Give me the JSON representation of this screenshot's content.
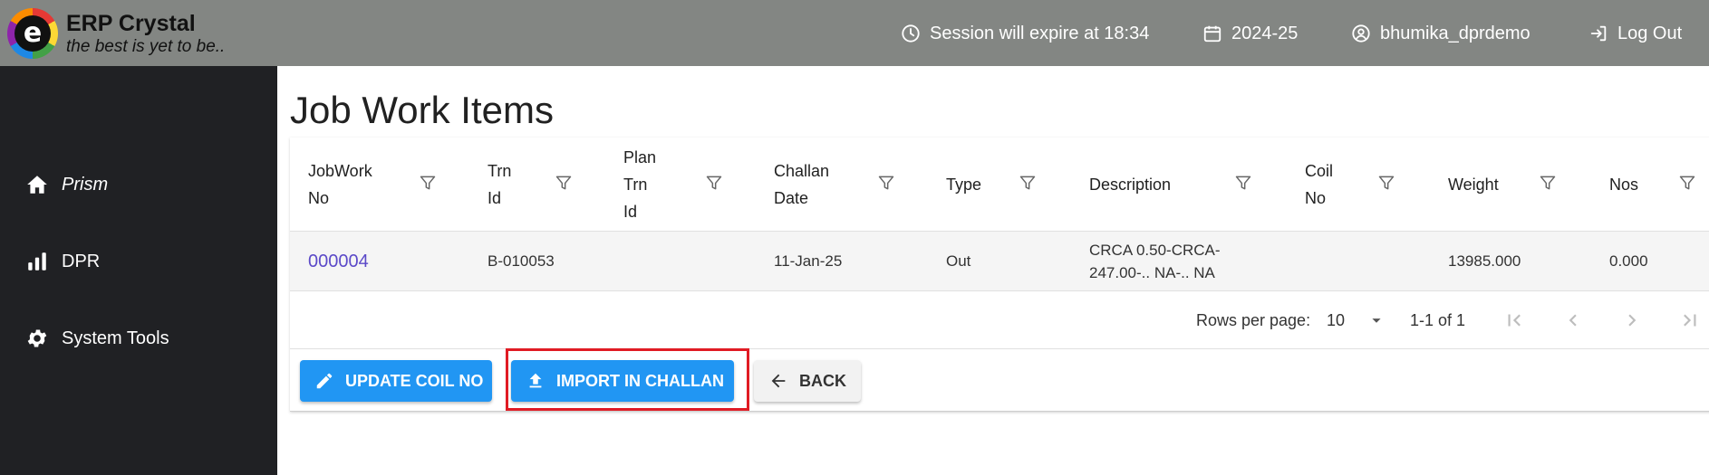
{
  "header": {
    "brand_name": "ERP Crystal",
    "brand_tagline": "the best is yet to be..",
    "session_text": "Session will expire at 18:34",
    "financial_year": "2024-25",
    "username": "bhumika_dprdemo",
    "logout_label": "Log Out",
    "bg_color": "#838683"
  },
  "sidebar": {
    "items": [
      {
        "label": "Prism",
        "icon": "home-icon"
      },
      {
        "label": "DPR",
        "icon": "bar-chart-icon"
      },
      {
        "label": "System Tools",
        "icon": "gear-icon"
      }
    ]
  },
  "page": {
    "title": "Job Work Items"
  },
  "table": {
    "columns": [
      {
        "label": "JobWork\nNo"
      },
      {
        "label": "Trn\nId"
      },
      {
        "label": "Plan\nTrn\nId"
      },
      {
        "label": "Challan\nDate"
      },
      {
        "label": "Type"
      },
      {
        "label": "Description"
      },
      {
        "label": "Coil\nNo"
      },
      {
        "label": "Weight"
      },
      {
        "label": "Nos"
      }
    ],
    "rows": [
      {
        "jobwork_no": "000004",
        "trn_id": "B-010053",
        "plan_trn_id": "",
        "challan_date": "11-Jan-25",
        "type": "Out",
        "description": "CRCA 0.50-CRCA-\n247.00-.. NA-.. NA",
        "coil_no": "",
        "weight": "13985.000",
        "nos": "0.000"
      }
    ]
  },
  "pagination": {
    "rows_per_page_label": "Rows per page:",
    "rows_per_page_value": "10",
    "range_text": "1-1 of 1"
  },
  "actions": {
    "update_coil_label": "UPDATE COIL NO",
    "import_challan_label": "IMPORT IN CHALLAN",
    "back_label": "BACK",
    "primary_color": "#2196f3",
    "highlight_color": "#e01b24"
  }
}
